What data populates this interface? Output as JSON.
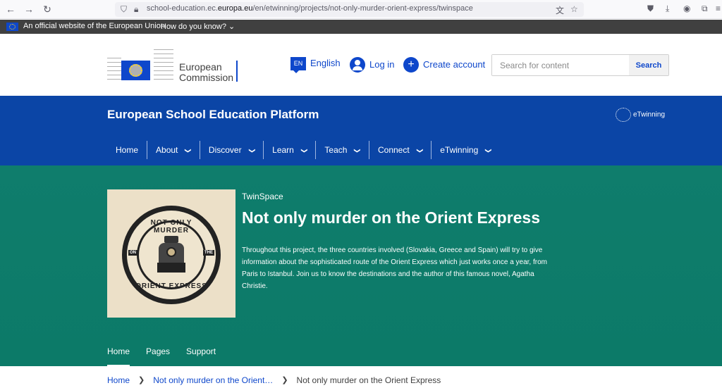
{
  "browser": {
    "url_prefix": "school-education.ec.",
    "url_domain": "europa.eu",
    "url_path": "/en/etwinning/projects/not-only-murder-orient-express/twinspace"
  },
  "eu_banner": {
    "official_text": "An official website of the European Union",
    "how_text": "How do you know?"
  },
  "header": {
    "logo_line1": "European",
    "logo_line2": "Commission",
    "lang_code": "EN",
    "lang_label": "English",
    "login_label": "Log in",
    "create_label": "Create account",
    "search_placeholder": "Search for content",
    "search_button": "Search"
  },
  "site": {
    "title": "European School Education Platform",
    "etwinning_logo": "eTwinning",
    "menu": [
      {
        "label": "Home"
      },
      {
        "label": "About"
      },
      {
        "label": "Discover"
      },
      {
        "label": "Learn"
      },
      {
        "label": "Teach"
      },
      {
        "label": "Connect"
      },
      {
        "label": "eTwinning"
      }
    ]
  },
  "hero": {
    "emblem_top": "NOT ONLY MURDER",
    "emblem_left": "ON",
    "emblem_right": "THE",
    "emblem_bottom": "ORIENT EXPRESS",
    "kicker": "TwinSpace",
    "title": "Not only murder on the Orient Express",
    "description": "Throughout this project, the three countries involved (Slovakia, Greece and Spain) will try to give information about the sophisticated route of the Orient Express which just works once a year, from Paris to Istanbul. Join us to know the destinations and the author of this famous novel, Agatha Christie.",
    "tabs": [
      {
        "label": "Home"
      },
      {
        "label": "Pages"
      },
      {
        "label": "Support"
      }
    ]
  },
  "breadcrumb": {
    "home": "Home",
    "parent": "Not only murder on the Orient…",
    "current": "Not only murder on the Orient Express"
  }
}
